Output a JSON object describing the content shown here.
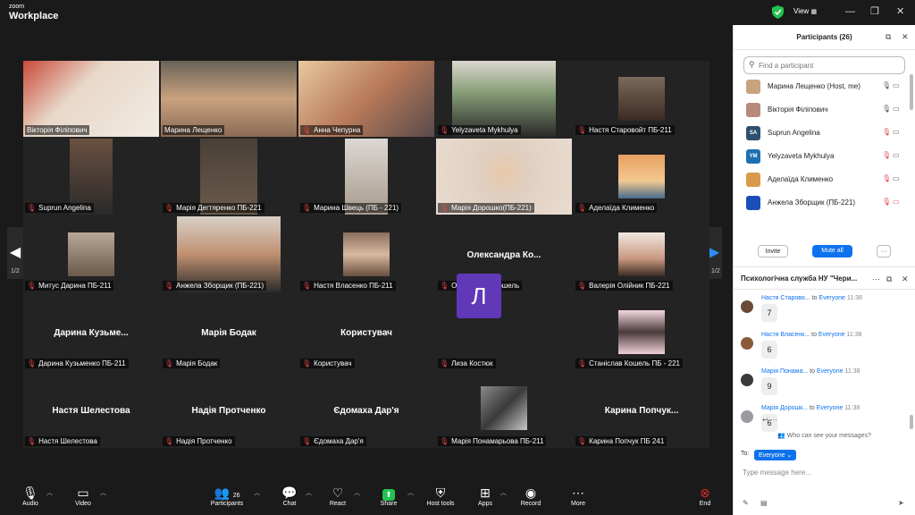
{
  "app": {
    "brand_top": "zoom",
    "brand_bottom": "Workplace",
    "view_label": "View",
    "min_glyph": "—",
    "max_glyph": "❐",
    "close_glyph": "✕",
    "accent": "#0e72ed",
    "active_speaker_color": "#37c24a",
    "muted_color": "#e64545"
  },
  "gallery": {
    "page_left": "1/2",
    "page_right": "1/2",
    "left_arrow": "◀",
    "right_arrow": "▶",
    "tiles": [
      {
        "label": "Вікторія Філіпович",
        "bigname": "",
        "video": true
      },
      {
        "label": "Марина Лещенко",
        "bigname": "",
        "video": true
      },
      {
        "label": "Анна Чепурна",
        "bigname": "",
        "video": true
      },
      {
        "label": "Yelyzaveta Mykhulya",
        "bigname": "",
        "video": true
      },
      {
        "label": "Настя Старовойт ПБ-211",
        "bigname": "",
        "video": true
      },
      {
        "label": "Suprun Angelina",
        "bigname": "",
        "video": true
      },
      {
        "label": "Марія Дегтяренко ПБ-221",
        "bigname": "",
        "video": true
      },
      {
        "label": "Марина Швець (ПБ - 221)",
        "bigname": "",
        "video": true
      },
      {
        "label": "Марія Дорошко(ПБ-221)",
        "bigname": "",
        "video": true
      },
      {
        "label": "Аделаїда Клименко",
        "bigname": "",
        "video": true
      },
      {
        "label": "Митус Дарина ПБ-211",
        "bigname": "",
        "video": true
      },
      {
        "label": "Анжела Зборщик (ПБ-221)",
        "bigname": "",
        "video": true
      },
      {
        "label": "Настя Власенко ПБ-211",
        "bigname": "",
        "video": true
      },
      {
        "label": "Олександра Кошель",
        "bigname": "Олександра Ко...",
        "video": false
      },
      {
        "label": "Валерія Олійник ПБ-221",
        "bigname": "",
        "video": true
      },
      {
        "label": "Дарина Кузьменко ПБ-211",
        "bigname": "Дарина Кузьме...",
        "video": false
      },
      {
        "label": "Марія Бодак",
        "bigname": "Марія Бодак",
        "video": false
      },
      {
        "label": "Користувач",
        "bigname": "Користувач",
        "video": false
      },
      {
        "label": "Лиза Костюк",
        "bigname": "",
        "video": false
      },
      {
        "label": "Станіслав Кошель ПБ - 221",
        "bigname": "",
        "video": true
      },
      {
        "label": "Настя Шелестова",
        "bigname": "Настя Шелестова",
        "video": false
      },
      {
        "label": "Надія Протченко",
        "bigname": "Надія Протченко",
        "video": false
      },
      {
        "label": "Єдомаха Дар'я",
        "bigname": "Єдомаха Дар'я",
        "video": false
      },
      {
        "label": "Марія Понамарьова ПБ-211",
        "bigname": "",
        "video": true
      },
      {
        "label": "Карина Попчук ПБ 241",
        "bigname": "Карина Попчук...",
        "video": false
      }
    ],
    "avatar_letter": "Л"
  },
  "toolbar": {
    "audio": "Audio",
    "video": "Video",
    "participants": "Participants",
    "participants_count": "26",
    "chat": "Chat",
    "react": "React",
    "share": "Share",
    "host_tools": "Host tools",
    "apps": "Apps",
    "record": "Record",
    "more": "More",
    "end": "End"
  },
  "participants_panel": {
    "title": "Participants (26)",
    "search_placeholder": "Find a participant",
    "items": [
      {
        "name": "Марина Лещенко (Host, me)",
        "initials": "",
        "color": "#c9a27e"
      },
      {
        "name": "Вікторія Філіпович",
        "initials": "",
        "color": "#b68a7a"
      },
      {
        "name": "Suprun Angelina",
        "initials": "SA",
        "color": "#2f4f6f"
      },
      {
        "name": "Yelyzaveta Mykhulya",
        "initials": "YM",
        "color": "#1f6fb0"
      },
      {
        "name": "Аделаїда Клименко",
        "initials": "",
        "color": "#d99a4a"
      },
      {
        "name": "Анжела Зборщик (ПБ-221)",
        "initials": "",
        "color": "#1a4fb8"
      }
    ],
    "invite": "Invite",
    "mute_all": "Mute all",
    "more": "···"
  },
  "chat_panel": {
    "title": "Психологічна служба НУ \"Чери...",
    "messages": [
      {
        "sender": "Настя Старово...",
        "to": "to",
        "target": "Everyone",
        "time": "11:38",
        "text": "7",
        "color": "#6b4a3a"
      },
      {
        "sender": "Настя Власенк...",
        "to": "to",
        "target": "Everyone",
        "time": "11:38",
        "text": "6",
        "color": "#8a5a3a"
      },
      {
        "sender": "Марія Понама...",
        "to": "to",
        "target": "Everyone",
        "time": "11:38",
        "text": "9",
        "color": "#3a3a3a"
      },
      {
        "sender": "Марія Дорошк...",
        "to": "to",
        "target": "Everyone",
        "time": "11:38",
        "text": "6",
        "color": "#9a9aa0"
      }
    ],
    "who_can_see": "Who can see your messages?",
    "to_label": "To:",
    "recipient": "Everyone",
    "placeholder": "Type message here..."
  }
}
